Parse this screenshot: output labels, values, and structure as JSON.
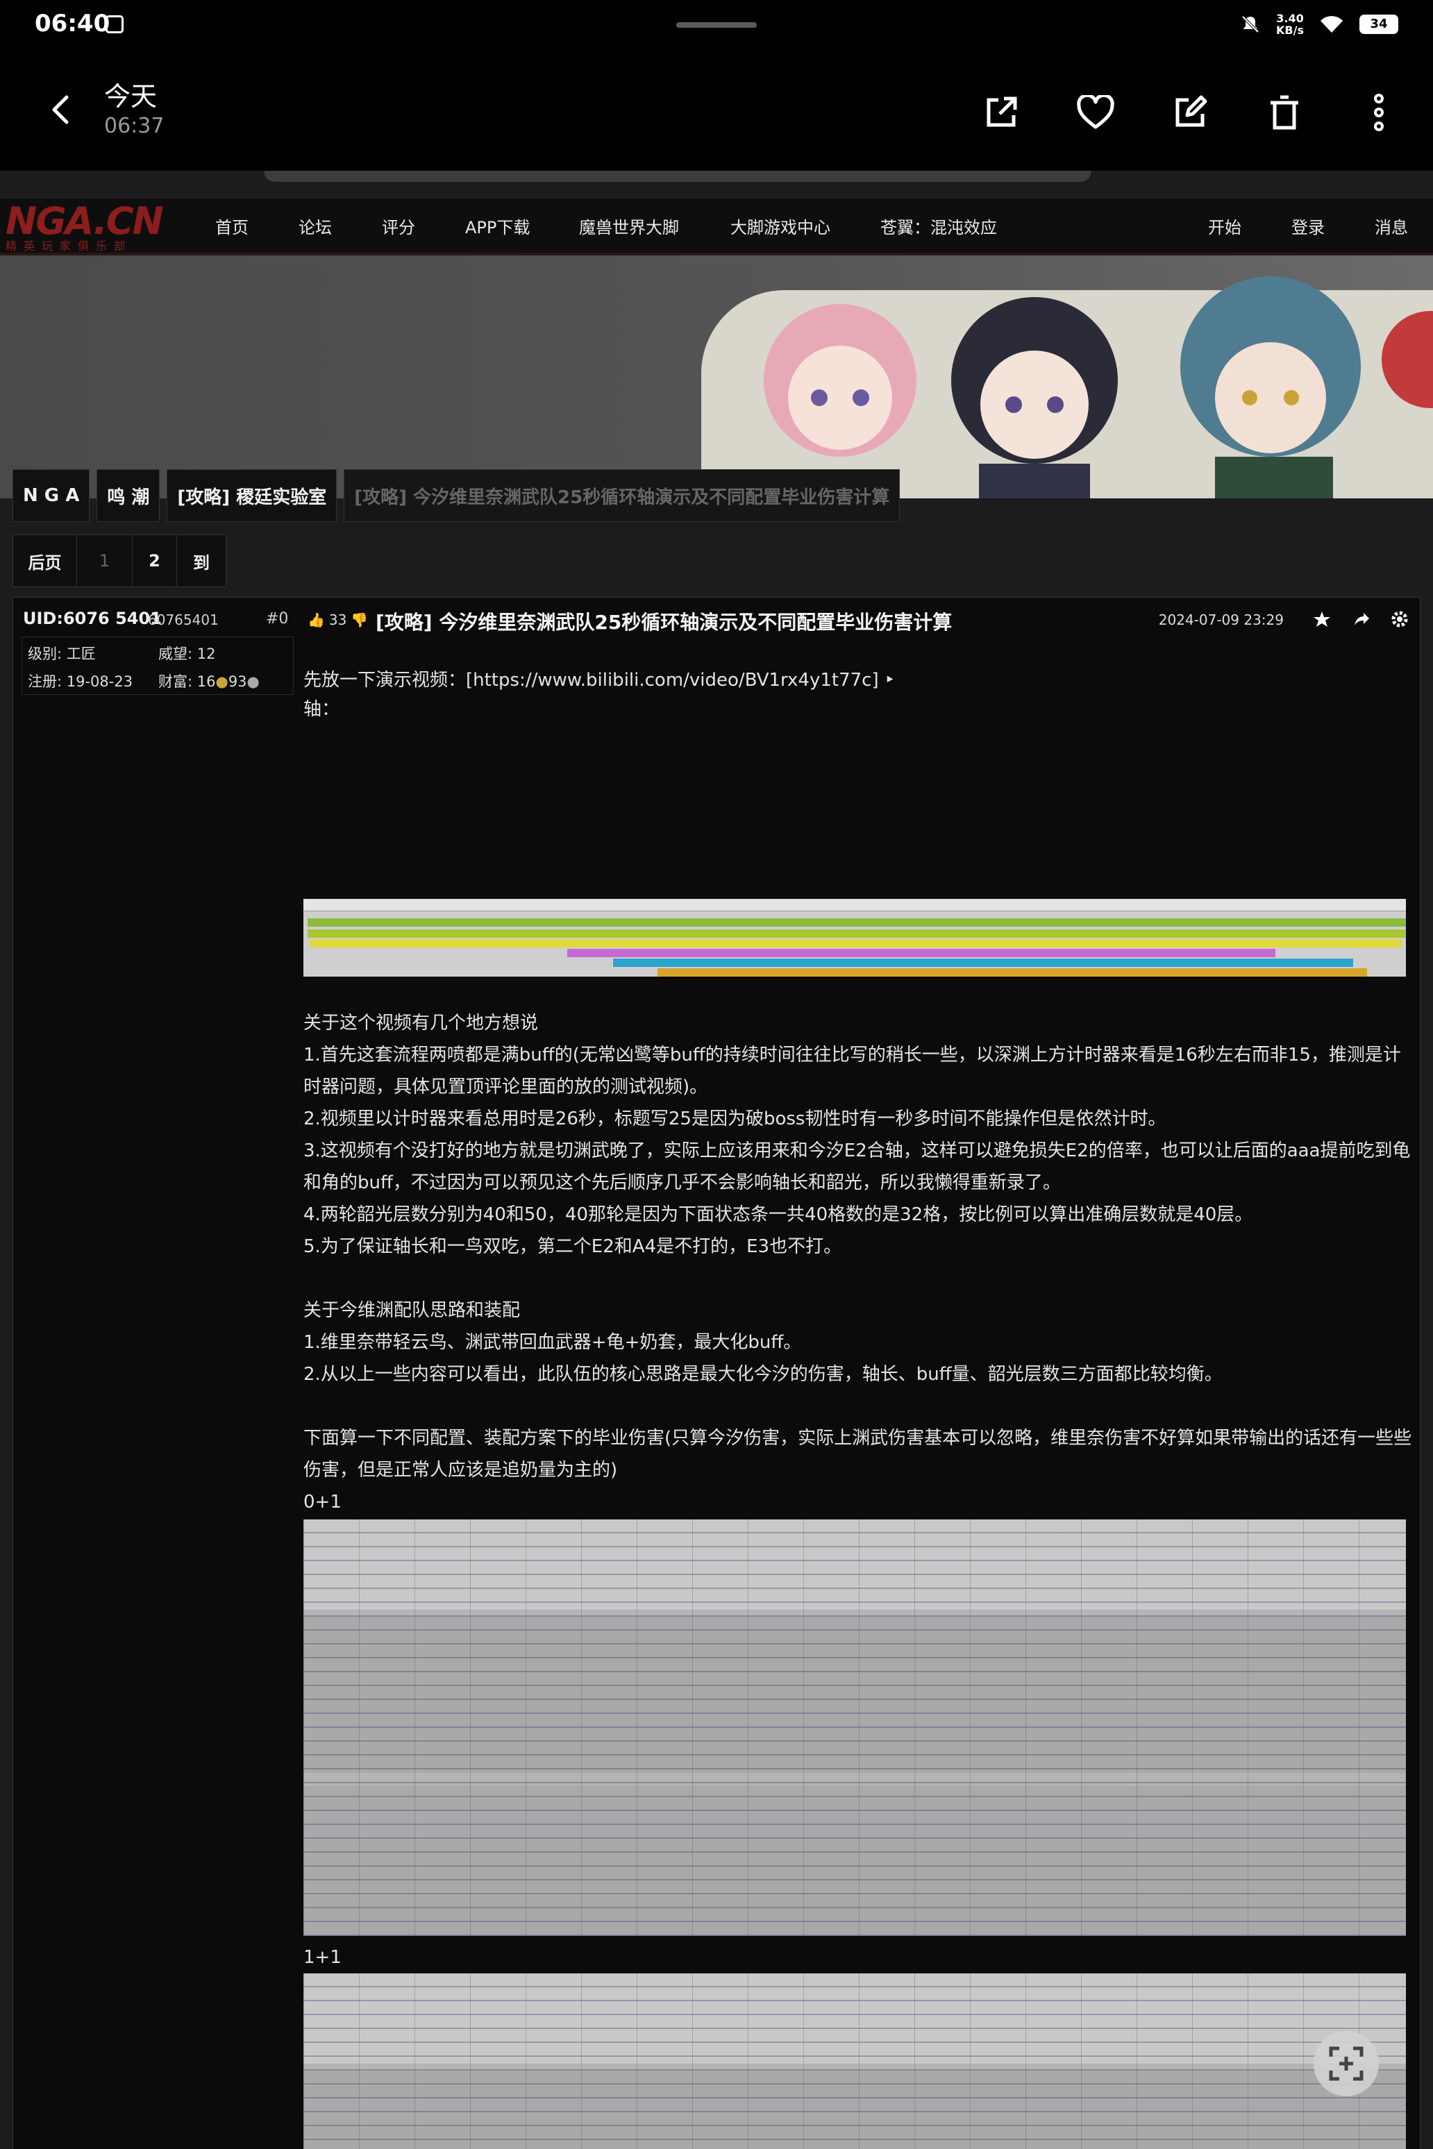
{
  "status_bar": {
    "time": "06:40",
    "net_speed": "3.40",
    "net_unit": "KB/s",
    "battery": "34"
  },
  "toolbar": {
    "title": "今天",
    "subtitle": "06:37",
    "icons": [
      "back-icon",
      "open-external-icon",
      "heart-icon",
      "edit-icon",
      "delete-icon",
      "more-icon"
    ]
  },
  "site": {
    "logo": "NGA.CN",
    "logo_sub": "精英玩家俱乐部",
    "nav": [
      "首页",
      "论坛",
      "评分",
      "APP下载",
      "魔兽世界大脚",
      "大脚游戏中心",
      "苍翼：混沌效应",
      "开始",
      "登录",
      "消息"
    ]
  },
  "breadcrumbs": [
    "N G A",
    "鸣 潮",
    "[攻略] 稷廷实验室",
    "[攻略] 今汐维里奈渊武队25秒循环轴演示及不同配置毕业伤害计算"
  ],
  "pager": {
    "prev": "后页",
    "pages": [
      "1",
      "2"
    ],
    "go": "到"
  },
  "user": {
    "uid": "UID:6076 5401",
    "uid_num": "60765401",
    "floor": "#0",
    "level": "级别: 工匠",
    "prestige": "威望: 12",
    "registered": "注册: 19-08-23",
    "wealth": "财富: 16",
    "wealth_extra": "93"
  },
  "post": {
    "votes": "33",
    "title": "[攻略] 今汐维里奈渊武队25秒循环轴演示及不同配置毕业伤害计算",
    "date": "2024-07-09 23:29",
    "lines": {
      "video": "先放一下演示视频：[https://www.bilibili.com/video/BV1rx4y1t77c] ‣",
      "axis": "轴：",
      "thoughts_title": "关于这个视频有几个地方想说",
      "t1": "1.首先这套流程两喷都是满buff的(无常凶鹭等buff的持续时间往往比写的稍长一些，以深渊上方计时器来看是16秒左右而非15，推测是计时器问题，具体见置顶评论里面的放的测试视频)。",
      "t2": "2.视频里以计时器来看总用时是26秒，标题写25是因为破boss韧性时有一秒多时间不能操作但是依然计时。",
      "t3": "3.这视频有个没打好的地方就是切渊武晚了，实际上应该用来和今汐E2合轴，这样可以避免损失E2的倍率，也可以让后面的aaa提前吃到龟和角的buff，不过因为可以预见这个先后顺序几乎不会影响轴长和韶光，所以我懒得重新录了。",
      "t4": "4.两轮韶光层数分别为40和50，40那轮是因为下面状态条一共40格数的是32格，按比例可以算出准确层数就是40层。",
      "t5": "5.为了保证轴长和一鸟双吃，第二个E2和A4是不打的，E3也不打。",
      "team_title": "关于今维渊配队思路和装配",
      "m1": "1.维里奈带轻云鸟、渊武带回血武器+龟+奶套，最大化buff。",
      "m2": "2.从以上一些内容可以看出，此队伍的核心思路是最大化今汐的伤害，轴长、buff量、韶光层数三方面都比较均衡。",
      "calc": "下面算一下不同配置、装配方案下的毕业伤害(只算今汐伤害，实际上渊武伤害基本可以忽略，维里奈伤害不好算如果带输出的话还有一些些伤害，但是正常人应该是追奶量为主的)",
      "cfg1": "0+1",
      "cfg2": "1+1"
    }
  },
  "colors": {
    "background": "#000000",
    "page": "#1c1c1c",
    "nga_red": "#8e1d1d",
    "text": "#e4e4e4"
  }
}
